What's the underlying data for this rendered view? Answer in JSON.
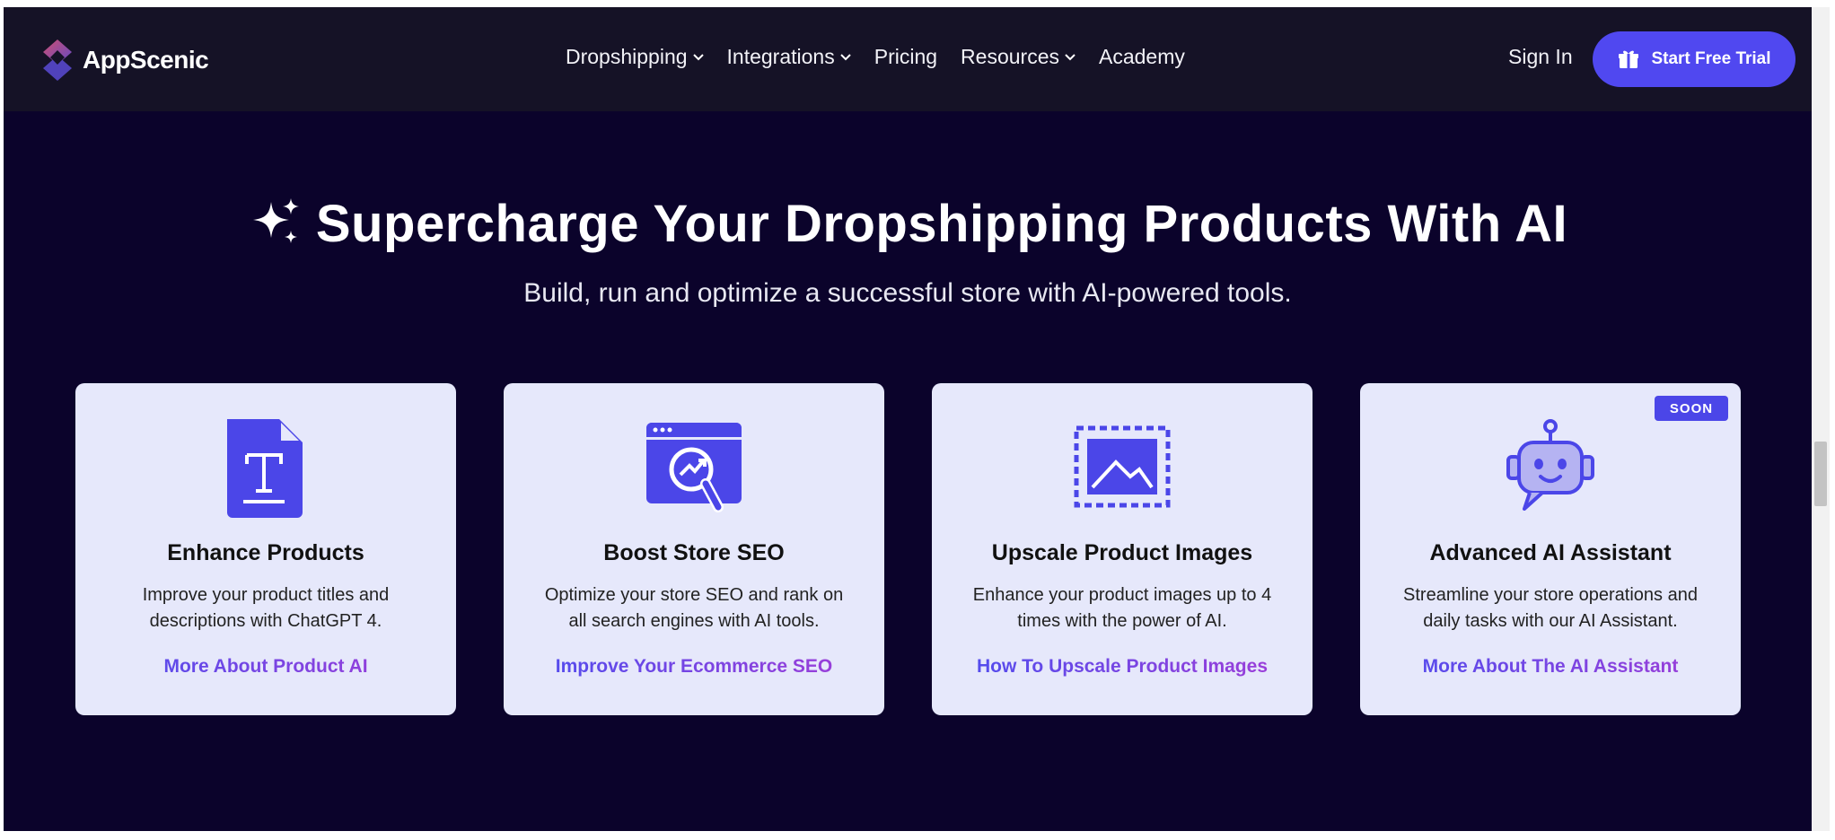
{
  "brand": {
    "name": "AppScenic"
  },
  "nav": {
    "items": [
      {
        "label": "Dropshipping",
        "has_dropdown": true
      },
      {
        "label": "Integrations",
        "has_dropdown": true
      },
      {
        "label": "Pricing",
        "has_dropdown": false
      },
      {
        "label": "Resources",
        "has_dropdown": true
      },
      {
        "label": "Academy",
        "has_dropdown": false
      }
    ],
    "sign_in": "Sign In",
    "cta_label": "Start Free Trial",
    "cta_icon": "gift-box-icon"
  },
  "hero": {
    "title": "Supercharge Your Dropshipping Products With AI",
    "title_icon": "sparkles-icon",
    "subtitle": "Build, run and optimize a successful store with AI-powered tools."
  },
  "cards": [
    {
      "icon": "text-document-icon",
      "title": "Enhance Products",
      "desc_line1": "Improve your product titles and",
      "desc_line2": "descriptions with ChatGPT 4.",
      "link": "More About Product AI"
    },
    {
      "icon": "seo-browser-icon",
      "title": "Boost Store SEO",
      "desc_line1": "Optimize your store SEO and rank on",
      "desc_line2": "all search engines with AI tools.",
      "link": "Improve Your Ecommerce SEO"
    },
    {
      "icon": "image-upscale-icon",
      "title": "Upscale Product Images",
      "desc_line1": "Enhance your product images up to 4",
      "desc_line2": "times with the power of AI.",
      "link": "How To Upscale Product Images"
    },
    {
      "icon": "robot-assistant-icon",
      "title": "Advanced AI Assistant",
      "desc_line1": "Streamline your store operations and",
      "desc_line2": "daily tasks with our AI Assistant.",
      "link": "More About The AI Assistant",
      "badge": "SOON"
    }
  ],
  "colors": {
    "background": "#0b032b",
    "nav_background": "#151226",
    "accent": "#5048f0",
    "card_background": "#e6e8fb"
  }
}
